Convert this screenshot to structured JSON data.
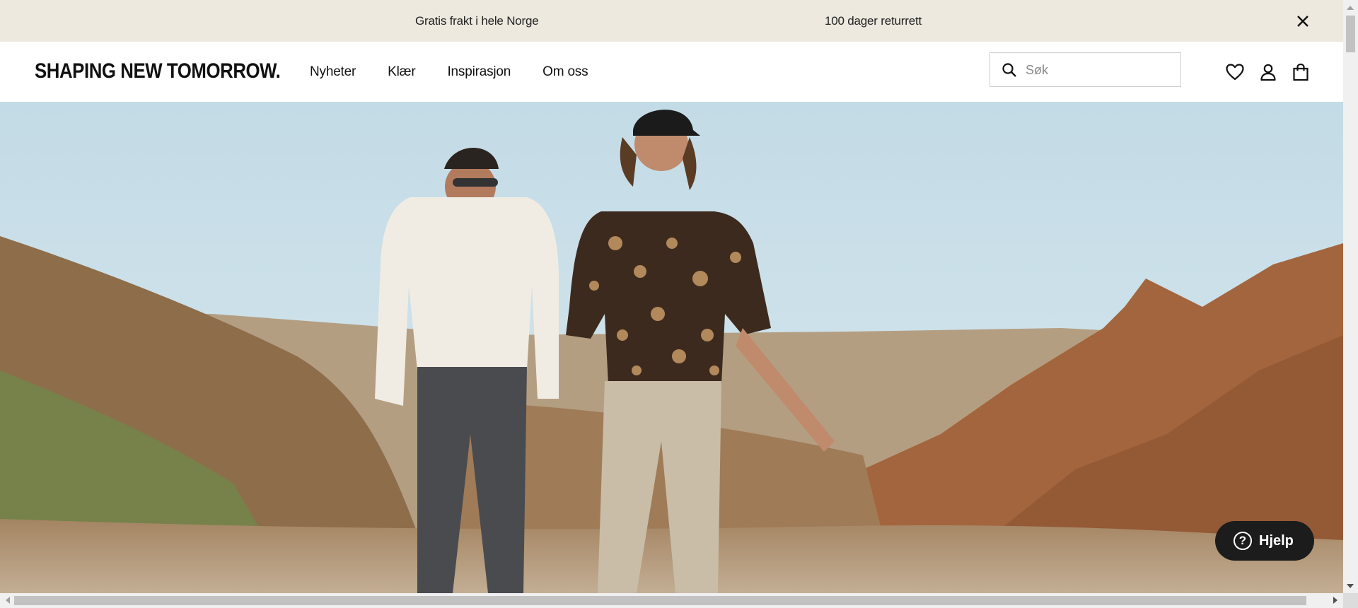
{
  "announcement": {
    "messages": [
      "Gratis frakt i hele Norge",
      "100 dager returrett"
    ],
    "close_icon": "close-icon"
  },
  "header": {
    "logo": "SHAPING NEW TOMORROW.",
    "nav": [
      "Nyheter",
      "Klær",
      "Inspirasjon",
      "Om oss"
    ],
    "search": {
      "placeholder": "Søk",
      "value": "",
      "icon": "search-icon"
    },
    "icons": [
      "heart-icon",
      "user-icon",
      "bag-icon"
    ]
  },
  "hero": {
    "image": "two-men-walking-desert-canyon"
  },
  "help": {
    "label": "Hjelp",
    "icon": "question-circle-icon"
  },
  "colors": {
    "announcement_bg": "#ede9df",
    "text": "#111111",
    "help_bg": "#1c1c1c"
  }
}
